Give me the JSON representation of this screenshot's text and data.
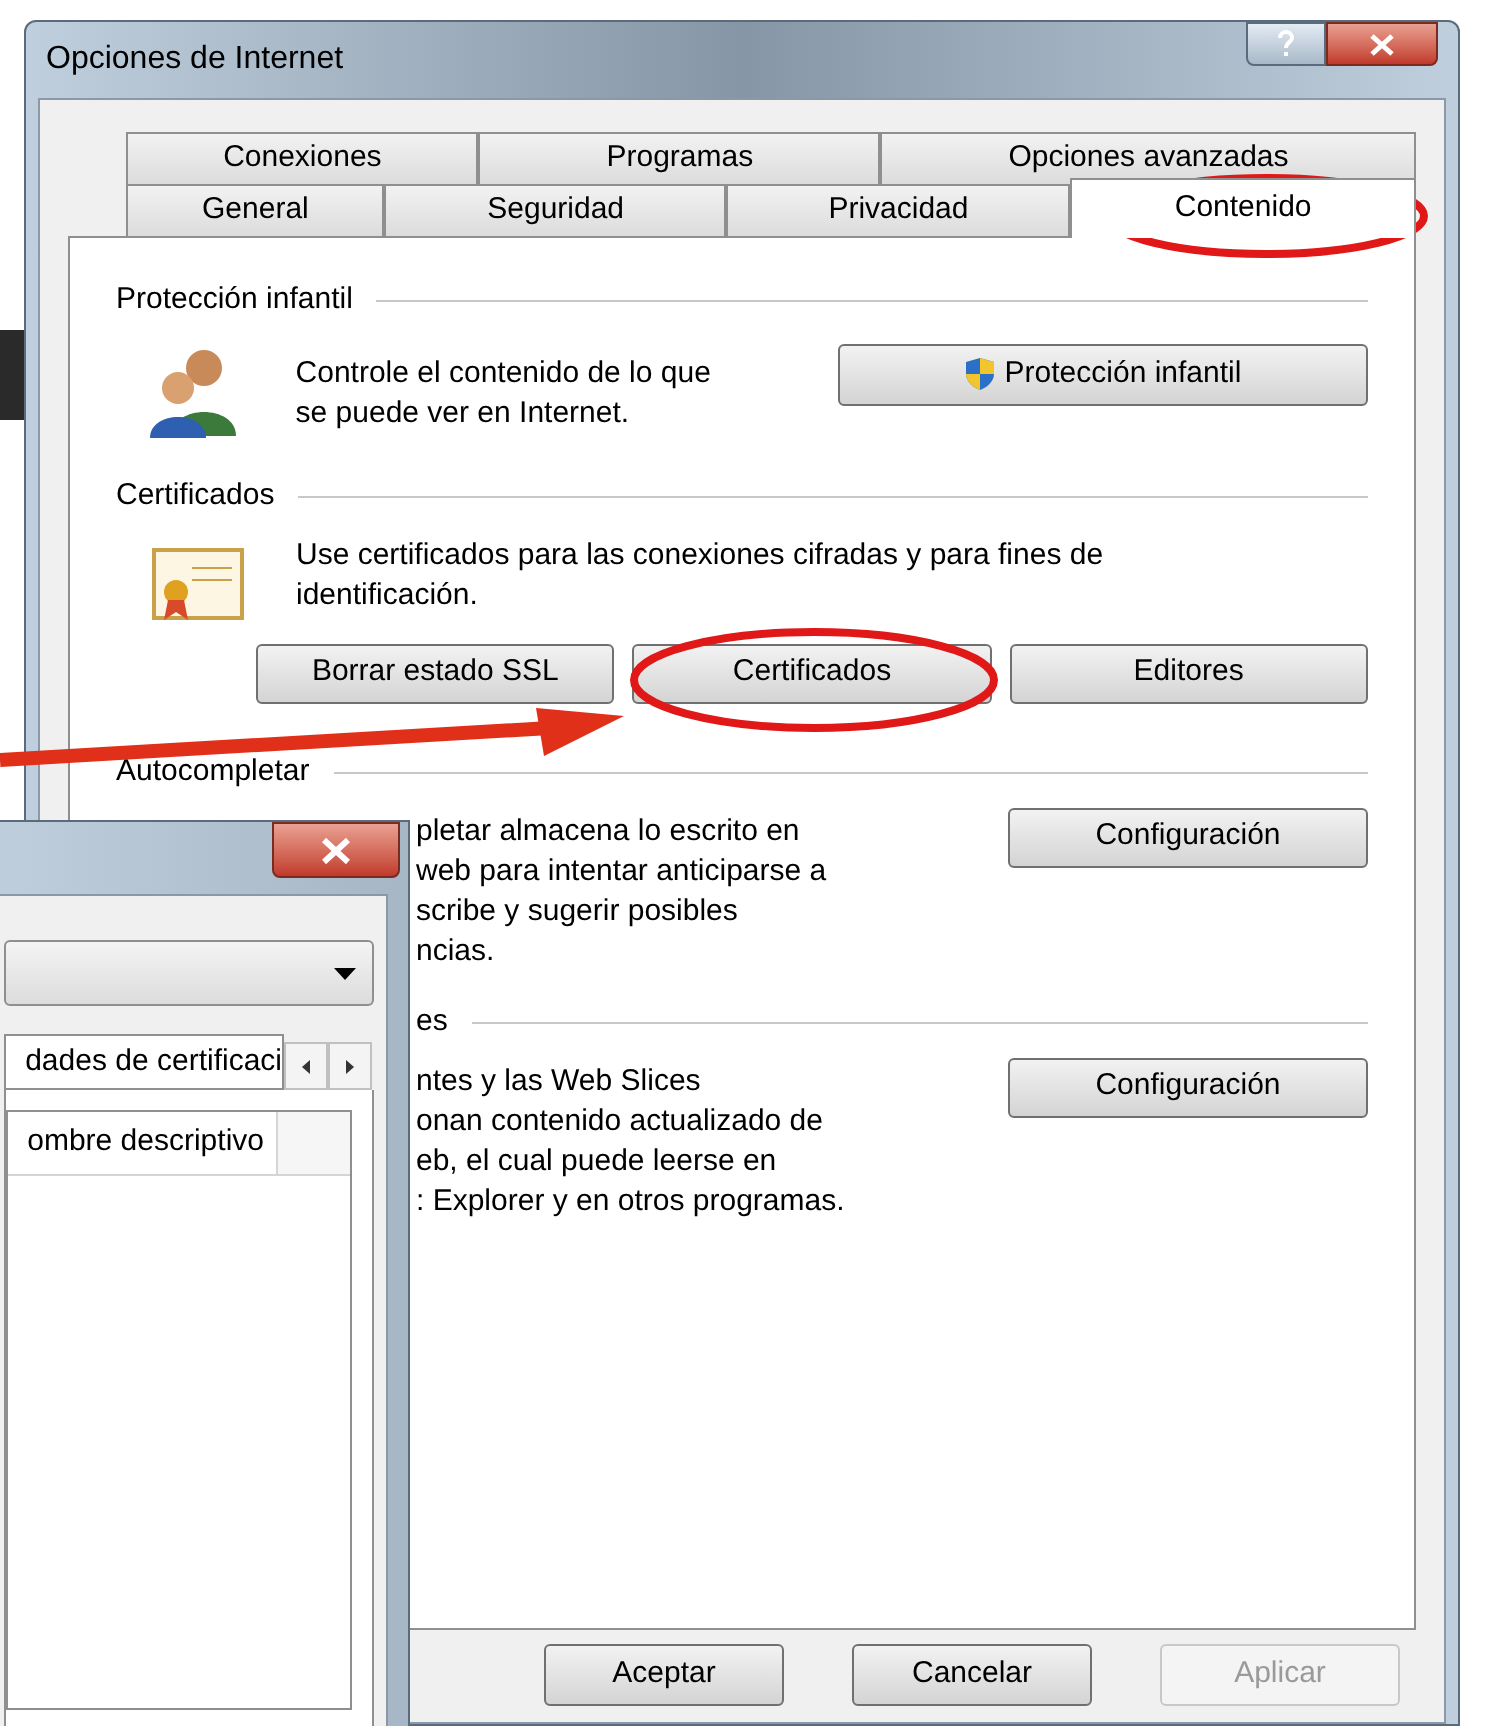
{
  "window": {
    "title": "Opciones de Internet"
  },
  "tab_rows": [
    [
      {
        "label": "Conexiones",
        "selected": false
      },
      {
        "label": "Programas",
        "selected": false
      },
      {
        "label": "Opciones avanzadas",
        "selected": false
      }
    ],
    [
      {
        "label": "General",
        "selected": false
      },
      {
        "label": "Seguridad",
        "selected": false
      },
      {
        "label": "Privacidad",
        "selected": false
      },
      {
        "label": "Contenido",
        "selected": true
      }
    ]
  ],
  "sections": [
    {
      "kind": "normal",
      "heading": "Protección infantil",
      "description": "Controle el contenido de lo que\nse puede ver en Internet.",
      "buttons": [
        {
          "label": "Protección infantil",
          "shield": true,
          "disabled": false
        }
      ]
    },
    {
      "kind": "normal",
      "heading": "Certificados",
      "description": "Use certificados para las conexiones cifradas y para fines de\nidentificación.",
      "buttons": [
        {
          "label": "Borrar estado SSL",
          "shield": false,
          "disabled": false
        },
        {
          "label": "Certificados",
          "shield": false,
          "disabled": false
        },
        {
          "label": "Editores",
          "shield": false,
          "disabled": false
        }
      ]
    },
    {
      "kind": "covered_text",
      "heading": "Autocompletar",
      "description": "pletar almacena lo escrito en\nweb para intentar anticiparse a\nscribe y sugerir posibles\nncias.",
      "buttons": [
        {
          "label": "Configuración",
          "shield": false,
          "disabled": false
        }
      ]
    },
    {
      "kind": "covered",
      "heading": "es",
      "description": "ntes y las Web Slices\nonan contenido actualizado de\neb, el cual puede leerse en\n: Explorer y en otros programas.",
      "buttons": [
        {
          "label": "Configuración",
          "shield": false,
          "disabled": false
        }
      ]
    }
  ],
  "footer_buttons": [
    {
      "label": "Aceptar",
      "disabled": false
    },
    {
      "label": "Cancelar",
      "disabled": false
    },
    {
      "label": "Aplicar",
      "disabled": true
    }
  ],
  "certificates_window": {
    "tab": "dades de certificaci",
    "list_column": "ombre descriptivo"
  }
}
